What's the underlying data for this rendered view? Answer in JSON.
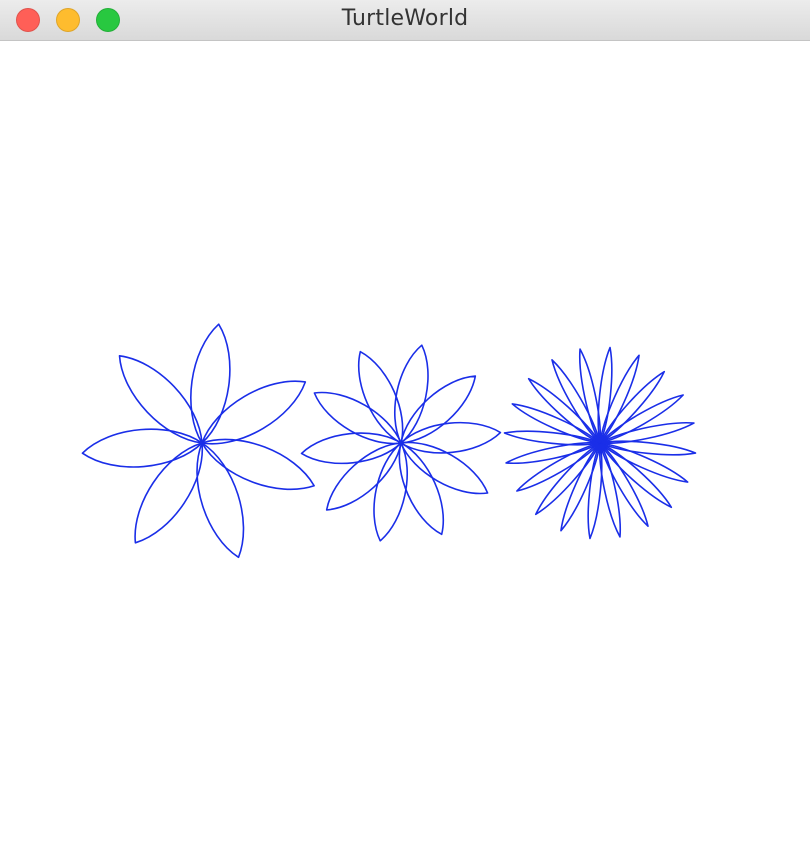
{
  "window": {
    "title": "TurtleWorld",
    "buttons": {
      "close_color": "#ff5f57",
      "minimize_color": "#febc2e",
      "zoom_color": "#28c840"
    }
  },
  "drawing": {
    "stroke_color": "#1a2ee8",
    "flowers": [
      {
        "name": "flower-7-petals",
        "petals": 7
      },
      {
        "name": "flower-10-petals",
        "petals": 10
      },
      {
        "name": "flower-20-petals",
        "petals": 20
      }
    ]
  }
}
